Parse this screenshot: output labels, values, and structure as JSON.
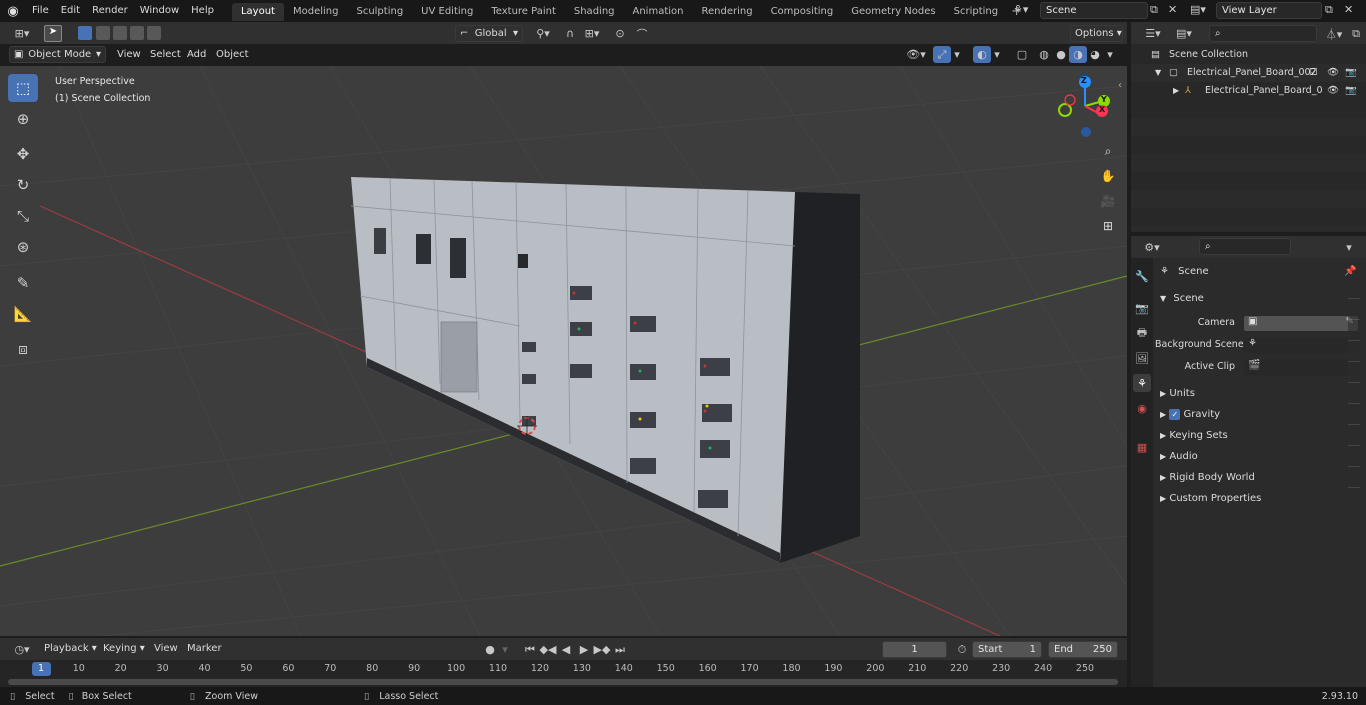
{
  "topbar": {
    "menus": [
      "File",
      "Edit",
      "Render",
      "Window",
      "Help"
    ],
    "workspaces": [
      "Layout",
      "Modeling",
      "Sculpting",
      "UV Editing",
      "Texture Paint",
      "Shading",
      "Animation",
      "Rendering",
      "Compositing",
      "Geometry Nodes",
      "Scripting"
    ],
    "active_workspace": "Layout",
    "scene_name": "Scene",
    "view_layer": "View Layer"
  },
  "viewport_header": {
    "mode": "Object Mode",
    "menus": [
      "View",
      "Select",
      "Add",
      "Object"
    ],
    "transform_orientation": "Global",
    "options_label": "Options"
  },
  "viewport": {
    "perspective_label": "User Perspective",
    "collection_label": "(1) Scene Collection",
    "gizmo_axes": {
      "x": "X",
      "y": "Y",
      "z": "Z"
    }
  },
  "outliner": {
    "root": "Scene Collection",
    "items": [
      {
        "name": "Electrical_Panel_Board_002"
      },
      {
        "name": "Electrical_Panel_Board_0"
      }
    ]
  },
  "properties": {
    "context_title": "Scene",
    "section": "Scene",
    "fields": [
      {
        "label": "Camera"
      },
      {
        "label": "Background Scene"
      },
      {
        "label": "Active Clip"
      }
    ],
    "panels": [
      "Units",
      "Gravity",
      "Keying Sets",
      "Audio",
      "Rigid Body World",
      "Custom Properties"
    ],
    "gravity_checked": true
  },
  "timeline": {
    "menus": [
      "Playback",
      "Keying",
      "View",
      "Marker"
    ],
    "current_frame": "1",
    "start_label": "Start",
    "start_value": "1",
    "end_label": "End",
    "end_value": "250",
    "ticks": [
      "1",
      "10",
      "20",
      "30",
      "40",
      "50",
      "60",
      "70",
      "80",
      "90",
      "100",
      "110",
      "120",
      "130",
      "140",
      "150",
      "160",
      "170",
      "180",
      "190",
      "200",
      "210",
      "220",
      "230",
      "240",
      "250"
    ]
  },
  "statusbar": {
    "items": [
      "Select",
      "Box Select",
      "Zoom View",
      "Lasso Select"
    ],
    "version": "2.93.10"
  },
  "colors": {
    "accent": "#4772b3",
    "x_axis": "#ff3352",
    "y_axis": "#8bdc00",
    "z_axis": "#2890ff"
  }
}
